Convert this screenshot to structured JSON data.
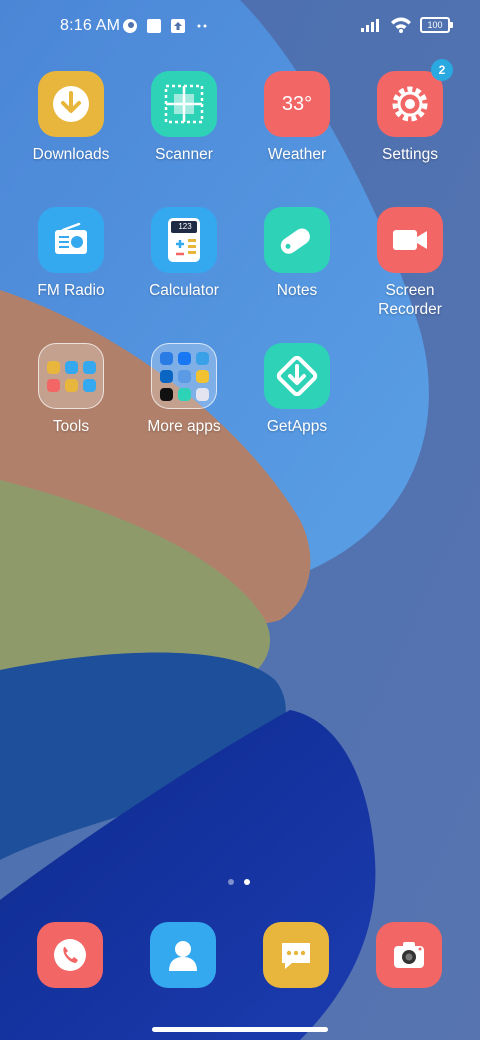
{
  "status_bar": {
    "time": "8:16 AM",
    "battery": "100"
  },
  "apps": [
    {
      "label": "Downloads",
      "icon": "downloads-icon",
      "color": "#e8b63c"
    },
    {
      "label": "Scanner",
      "icon": "scanner-icon",
      "color": "#2ed3b7"
    },
    {
      "label": "Weather",
      "icon": "weather-icon",
      "color": "#f26666",
      "text": "33°"
    },
    {
      "label": "Settings",
      "icon": "settings-icon",
      "color": "#f26666",
      "badge": "2"
    },
    {
      "label": "FM Radio",
      "icon": "radio-icon",
      "color": "#35a9f0"
    },
    {
      "label": "Calculator",
      "icon": "calculator-icon",
      "color": "#35a9f0",
      "text": "123"
    },
    {
      "label": "Notes",
      "icon": "notes-icon",
      "color": "#2ed3b7"
    },
    {
      "label": "Screen\nRecorder",
      "icon": "screen-recorder-icon",
      "color": "#f26666"
    },
    {
      "label": "Tools",
      "icon": "folder-icon"
    },
    {
      "label": "More apps",
      "icon": "folder-icon"
    },
    {
      "label": "GetApps",
      "icon": "getapps-icon",
      "color": "#2ed3b7"
    }
  ],
  "dock": [
    {
      "name": "phone-icon",
      "color": "#f26666"
    },
    {
      "name": "contacts-icon",
      "color": "#35a9f0"
    },
    {
      "name": "messages-icon",
      "color": "#e8b63c"
    },
    {
      "name": "camera-icon",
      "color": "#f26666"
    }
  ],
  "page_indicator": {
    "pages": 2,
    "current": 2
  }
}
